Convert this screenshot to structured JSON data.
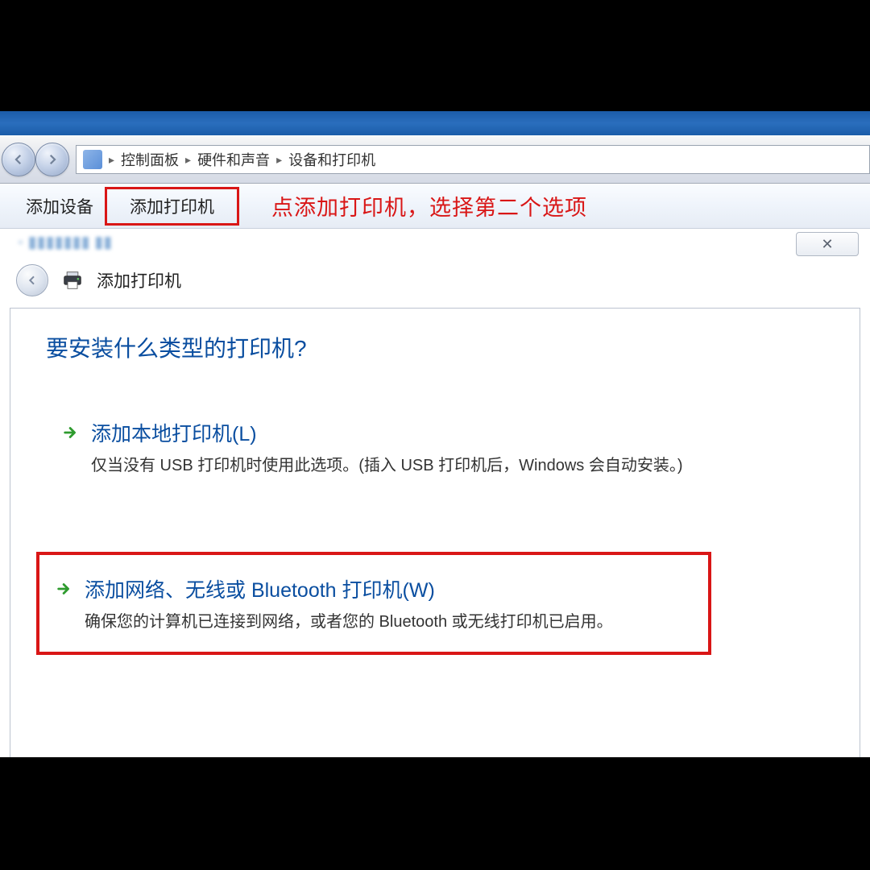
{
  "breadcrumb": {
    "items": [
      "控制面板",
      "硬件和声音",
      "设备和打印机"
    ]
  },
  "toolbar": {
    "add_device": "添加设备",
    "add_printer": "添加打印机"
  },
  "annotation": "点添加打印机，选择第二个选项",
  "close_glyph": "✕",
  "wizard": {
    "title": "添加打印机",
    "heading": "要安装什么类型的打印机?",
    "options": [
      {
        "title": "添加本地打印机(L)",
        "desc": "仅当没有 USB 打印机时使用此选项。(插入 USB 打印机后，Windows 会自动安装。)"
      },
      {
        "title": "添加网络、无线或 Bluetooth 打印机(W)",
        "desc": "确保您的计算机已连接到网络，或者您的 Bluetooth 或无线打印机已启用。"
      }
    ]
  }
}
